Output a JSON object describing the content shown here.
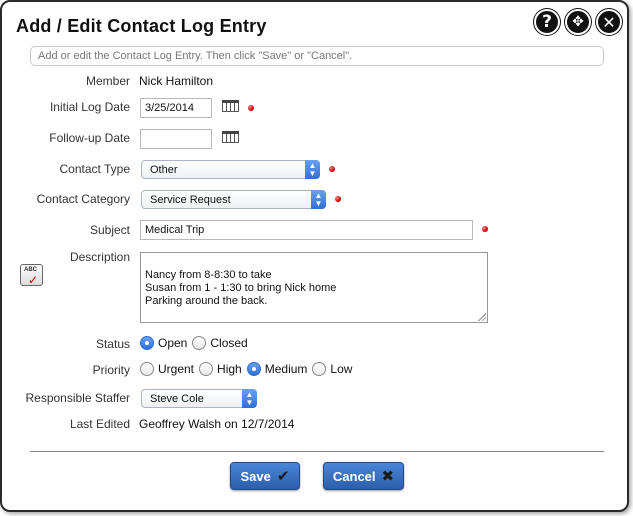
{
  "dialog": {
    "title": "Add / Edit Contact Log Entry",
    "instructions": "Add or edit the Contact Log Entry. Then click \"Save\" or \"Cancel\".",
    "icons": [
      "help-icon",
      "move-icon",
      "close-icon"
    ]
  },
  "labels": {
    "member": "Member",
    "initial_log_date": "Initial Log Date",
    "follow_up_date": "Follow-up Date",
    "contact_type": "Contact Type",
    "contact_category": "Contact Category",
    "subject": "Subject",
    "description": "Description",
    "status": "Status",
    "priority": "Priority",
    "responsible_staffer": "Responsible Staffer",
    "last_edited": "Last Edited"
  },
  "values": {
    "member": "Nick Hamilton",
    "initial_log_date": "3/25/2014",
    "follow_up_date": "",
    "contact_type": "Other",
    "contact_category": "Service Request",
    "subject": "Medical Trip",
    "description": "Nancy from 8-8:30 to take\nSusan from 1 - 1:30 to bring Nick home\nParking around the back.",
    "responsible_staffer": "Steve Cole",
    "last_edited": "Geoffrey Walsh on 12/7/2014"
  },
  "status_options": [
    {
      "label": "Open",
      "selected": true
    },
    {
      "label": "Closed",
      "selected": false
    }
  ],
  "priority_options": [
    {
      "label": "Urgent",
      "selected": false
    },
    {
      "label": "High",
      "selected": false
    },
    {
      "label": "Medium",
      "selected": true
    },
    {
      "label": "Low",
      "selected": false
    }
  ],
  "buttons": {
    "save": "Save",
    "cancel": "Cancel"
  },
  "colors": {
    "accent": "#2f6fd6",
    "button": "#3a72c4",
    "required": "#d00000"
  }
}
